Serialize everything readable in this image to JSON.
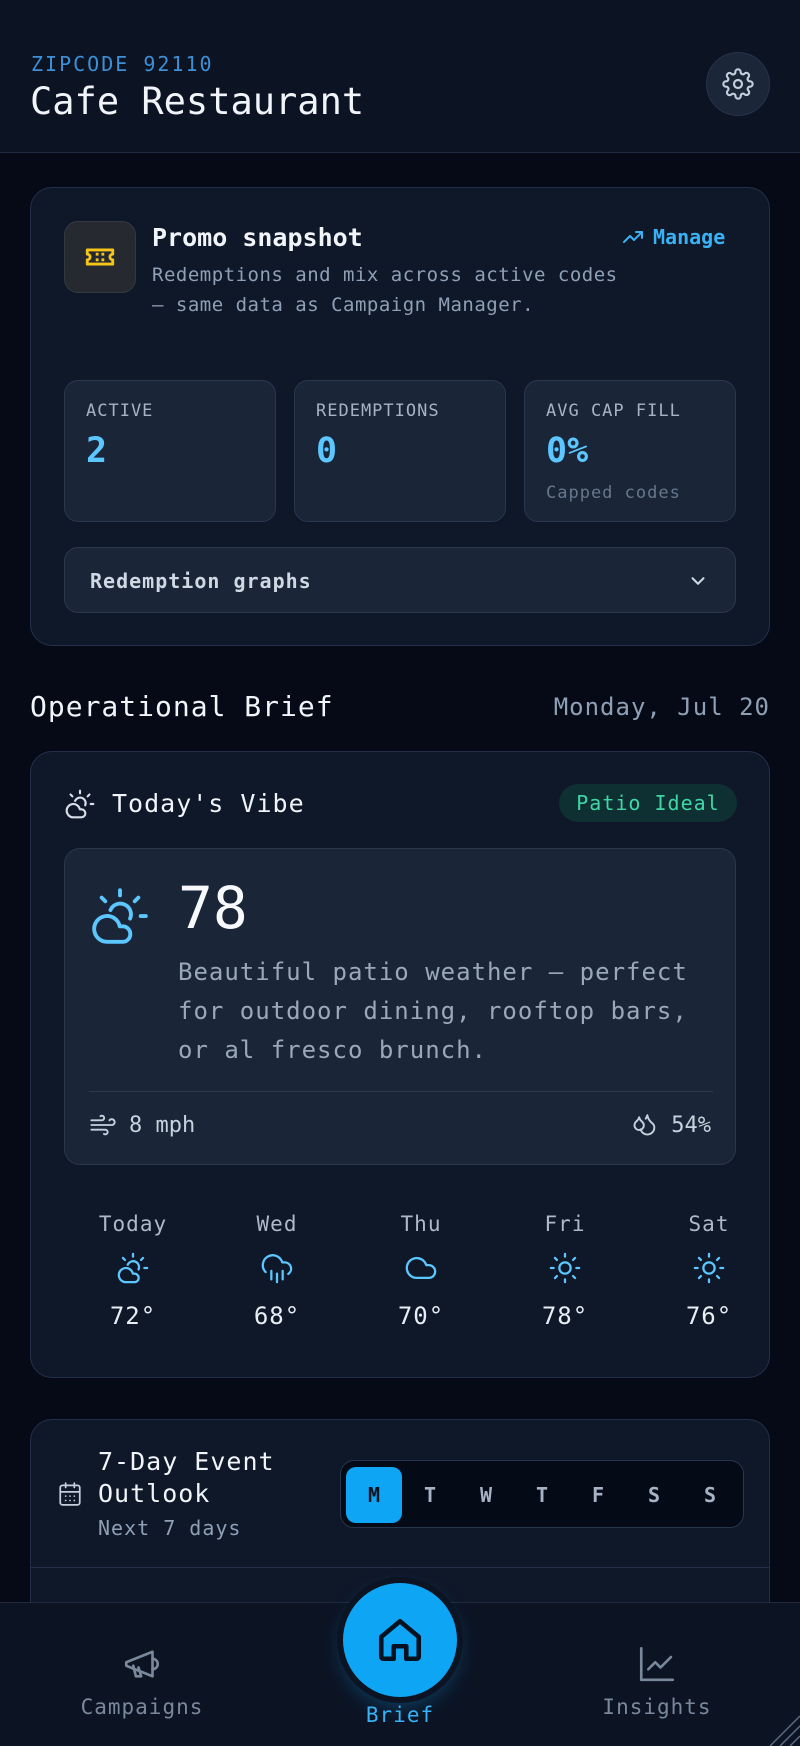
{
  "header": {
    "zipcode": "ZIPCODE 92110",
    "title": "Cafe Restaurant",
    "settings_icon": "gear-icon"
  },
  "promo": {
    "title": "Promo snapshot",
    "description": "Redemptions and mix across active codes — same data as Campaign Manager.",
    "manage_label": "Manage",
    "icon": "ticket-icon",
    "stats": [
      {
        "label": "ACTIVE",
        "value": "2",
        "sub": ""
      },
      {
        "label": "REDEMPTIONS",
        "value": "0",
        "sub": ""
      },
      {
        "label": "AVG CAP FILL",
        "value": "0%",
        "sub": "Capped codes"
      }
    ],
    "graphs_label": "Redemption graphs"
  },
  "brief": {
    "title": "Operational Brief",
    "date": "Monday, Jul 20"
  },
  "vibe": {
    "title": "Today's Vibe",
    "badge": "Patio Ideal",
    "temp": "78",
    "description": "Beautiful patio weather — perfect for outdoor dining, rooftop bars, or al fresco brunch.",
    "wind": "8 mph",
    "humidity": "54%",
    "forecast": [
      {
        "day": "Today",
        "temp": "72°",
        "icon": "partly-sunny-icon"
      },
      {
        "day": "Wed",
        "temp": "68°",
        "icon": "rain-icon"
      },
      {
        "day": "Thu",
        "temp": "70°",
        "icon": "cloud-icon"
      },
      {
        "day": "Fri",
        "temp": "78°",
        "icon": "sun-icon"
      },
      {
        "day": "Sat",
        "temp": "76°",
        "icon": "sun-icon"
      }
    ]
  },
  "events": {
    "title": "7-Day Event Outlook",
    "subtitle": "Next 7 days",
    "days": [
      "M",
      "T",
      "W",
      "T",
      "F",
      "S",
      "S"
    ],
    "selected_day": "M"
  },
  "nav": {
    "campaigns": "Campaigns",
    "brief": "Brief",
    "insights": "Insights"
  },
  "colors": {
    "accent": "#0ea5f5",
    "stat_value": "#5cc6ff",
    "badge_green": "#3fd6a6",
    "promo_icon": "#f5c518"
  }
}
